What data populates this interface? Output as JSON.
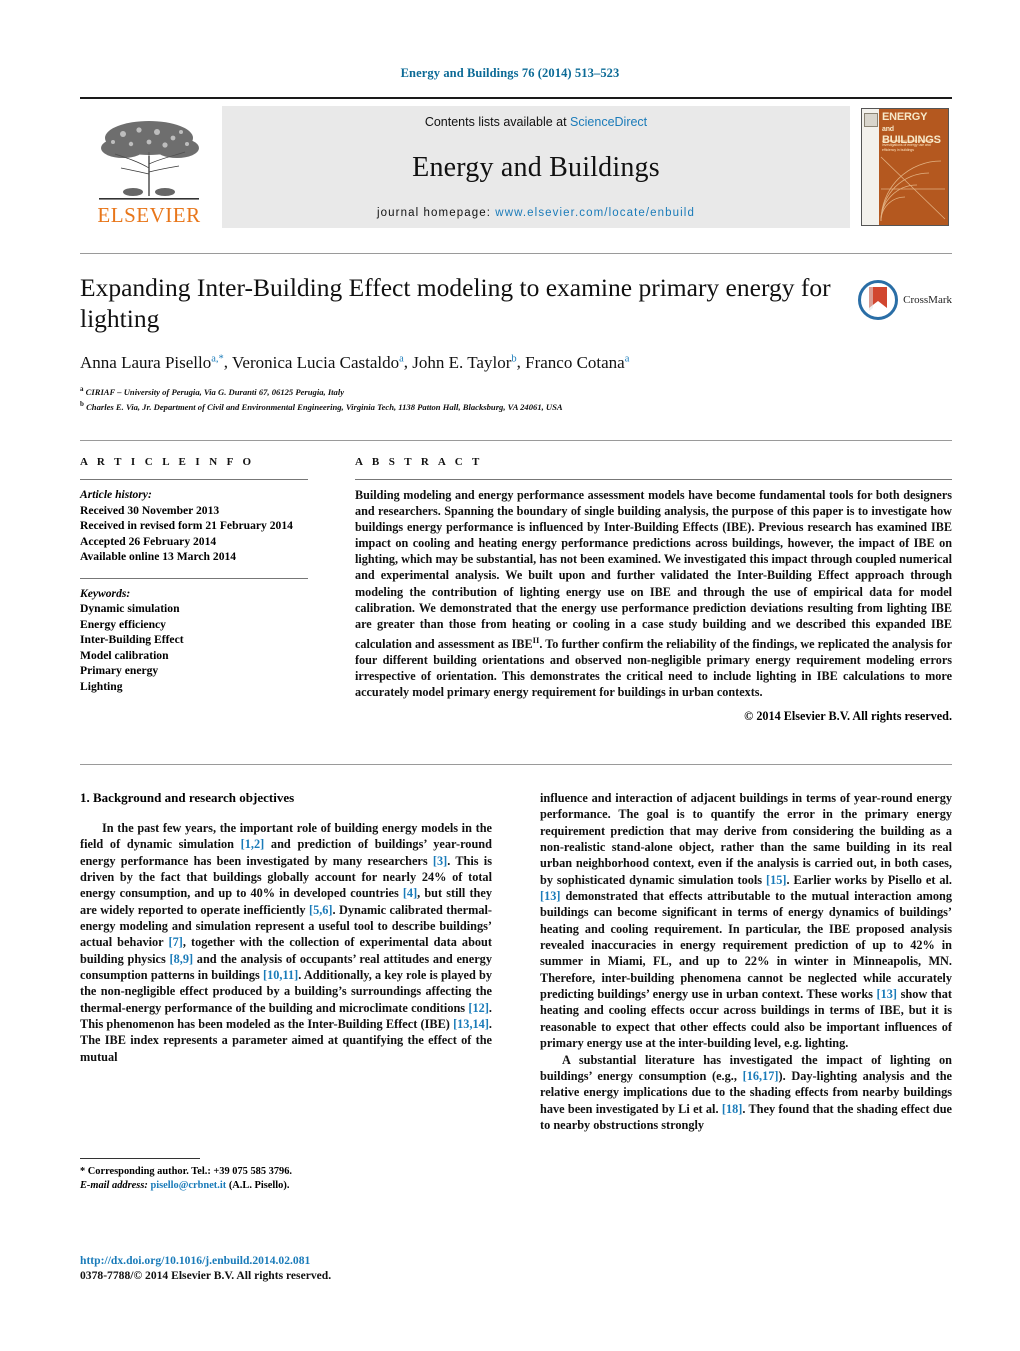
{
  "running_head": "Energy and Buildings 76 (2014) 513–523",
  "masthead": {
    "contents_prefix": "Contents lists available at ",
    "sciencedirect": "ScienceDirect",
    "journal_name": "Energy and Buildings",
    "homepage_prefix": "journal homepage: ",
    "homepage_url": "www.elsevier.com/locate/enbuild",
    "publisher": "ELSEVIER",
    "cover_title_line1": "ENERGY",
    "cover_title_line2": "BUILDINGS",
    "cover_and": "and",
    "cover_blurb": "An international journal devoted to investigations of energy use and efficiency in buildings",
    "accent_link": "#1a7bb9",
    "publisher_color": "#E8761A"
  },
  "article": {
    "title": "Expanding Inter-Building Effect modeling to examine primary energy for lighting",
    "crossmark_label": "CrossMark",
    "authors": [
      {
        "name": "Anna Laura Pisello",
        "marks": "a,*"
      },
      {
        "name": "Veronica Lucia Castaldo",
        "marks": "a"
      },
      {
        "name": "John E. Taylor",
        "marks": "b"
      },
      {
        "name": "Franco Cotana",
        "marks": "a"
      }
    ],
    "affiliations": [
      {
        "mark": "a",
        "text": "CIRIAF – University of Perugia, Via G. Duranti 67, 06125 Perugia, Italy"
      },
      {
        "mark": "b",
        "text": "Charles E. Via, Jr. Department of Civil and Environmental Engineering, Virginia Tech, 1138 Patton Hall, Blacksburg, VA 24061, USA"
      }
    ]
  },
  "article_info": {
    "section_label": "A R T I C L E    I N F O",
    "history_label": "Article history:",
    "history": [
      "Received 30 November 2013",
      "Received in revised form 21 February 2014",
      "Accepted 26 February 2014",
      "Available online 13 March 2014"
    ],
    "keywords_label": "Keywords:",
    "keywords": [
      "Dynamic simulation",
      "Energy efficiency",
      "Inter-Building Effect",
      "Model calibration",
      "Primary energy",
      "Lighting"
    ]
  },
  "abstract": {
    "section_label": "A B S T R A C T",
    "part1": "Building modeling and energy performance assessment models have become fundamental tools for both designers and researchers. Spanning the boundary of single building analysis, the purpose of this paper is to investigate how buildings energy performance is influenced by Inter-Building Effects (IBE). Previous research has examined IBE impact on cooling and heating energy performance predictions across buildings, however, the impact of IBE on lighting, which may be substantial, has not been examined. We investigated this impact through coupled numerical and experimental analysis. We built upon and further validated the Inter-Building Effect approach through modeling the contribution of lighting energy use on IBE and through the use of empirical data for model calibration. We demonstrated that the energy use performance prediction deviations resulting from lighting IBE are greater than those from heating or cooling in a case study building and we described this expanded IBE calculation and assessment as IBE",
    "superscript": "II",
    "part2": ". To further confirm the reliability of the findings, we replicated the analysis for four different building orientations and observed non-negligible primary energy requirement modeling errors irrespective of orientation. This demonstrates the critical need to include lighting in IBE calculations to more accurately model primary energy requirement for buildings in urban contexts.",
    "copyright": "© 2014 Elsevier B.V. All rights reserved."
  },
  "body": {
    "section_number_title": "1.  Background and research objectives",
    "left_paragraphs": [
      {
        "segments": [
          {
            "t": "In the past few years, the important role of building energy models in the field of dynamic simulation "
          },
          {
            "t": "[1,2]",
            "ref": true
          },
          {
            "t": " and prediction of buildings’ year-round energy performance has been investigated by many researchers "
          },
          {
            "t": "[3]",
            "ref": true
          },
          {
            "t": ". This is driven by the fact that buildings globally account for nearly 24% of total energy consumption, and up to 40% in developed countries "
          },
          {
            "t": "[4]",
            "ref": true
          },
          {
            "t": ", but still they are widely reported to operate inefficiently "
          },
          {
            "t": "[5,6]",
            "ref": true
          },
          {
            "t": ". Dynamic calibrated thermal-energy modeling and simulation represent a useful tool to describe buildings’ actual behavior "
          },
          {
            "t": "[7]",
            "ref": true
          },
          {
            "t": ", together with the collection of experimental data about building physics "
          },
          {
            "t": "[8,9]",
            "ref": true
          },
          {
            "t": " and the analysis of occupants’ real attitudes and energy consumption patterns in buildings "
          },
          {
            "t": "[10,11]",
            "ref": true
          },
          {
            "t": ". Additionally, a key role is played by the non-negligible effect produced by a building’s surroundings affecting the thermal-energy performance of the building and microclimate conditions "
          },
          {
            "t": "[12]",
            "ref": true
          },
          {
            "t": ". This phenomenon has been modeled as the Inter-Building Effect (IBE) "
          },
          {
            "t": "[13,14]",
            "ref": true
          },
          {
            "t": ". The IBE index represents a parameter aimed at quantifying the effect of the mutual"
          }
        ]
      }
    ],
    "right_paragraphs": [
      {
        "indent": false,
        "segments": [
          {
            "t": "influence and interaction of adjacent buildings in terms of year-round energy performance. The goal is to quantify the error in the primary energy requirement prediction that may derive from considering the building as a non-realistic stand-alone object, rather than the same building in its real urban neighborhood context, even if the analysis is carried out, in both cases, by sophisticated dynamic simulation tools "
          },
          {
            "t": "[15]",
            "ref": true
          },
          {
            "t": ". Earlier works by Pisello et al. "
          },
          {
            "t": "[13]",
            "ref": true
          },
          {
            "t": " demonstrated that effects attributable to the mutual interaction among buildings can become significant in terms of energy dynamics of buildings’ heating and cooling requirement. In particular, the IBE proposed analysis revealed inaccuracies in energy requirement prediction of up to 42% in summer in Miami, FL, and up to 22% in winter in Minneapolis, MN. Therefore, inter-building phenomena cannot be neglected while accurately predicting buildings’ energy use in urban context. These works "
          },
          {
            "t": "[13]",
            "ref": true
          },
          {
            "t": " show that heating and cooling effects occur across buildings in terms of IBE, but it is reasonable to expect that other effects could also be important influences of primary energy use at the inter-building level, e.g. lighting."
          }
        ]
      },
      {
        "indent": true,
        "segments": [
          {
            "t": "A substantial literature has investigated the impact of lighting on buildings’ energy consumption (e.g., "
          },
          {
            "t": "[16,17]",
            "ref": true
          },
          {
            "t": "). Day-lighting analysis and the relative energy implications due to the shading effects from nearby buildings have been investigated by Li et al. "
          },
          {
            "t": "[18]",
            "ref": true
          },
          {
            "t": ". They found that the shading effect due to nearby obstructions strongly"
          }
        ]
      }
    ]
  },
  "footnote": {
    "corresponding": "*  Corresponding author. Tel.: +39 075 585 3796.",
    "email_label": "E-mail address:",
    "email": "pisello@crbnet.it",
    "email_suffix": "(A.L. Pisello)."
  },
  "footer": {
    "doi": "http://dx.doi.org/10.1016/j.enbuild.2014.02.081",
    "issn_line": "0378-7788/© 2014 Elsevier B.V. All rights reserved."
  }
}
